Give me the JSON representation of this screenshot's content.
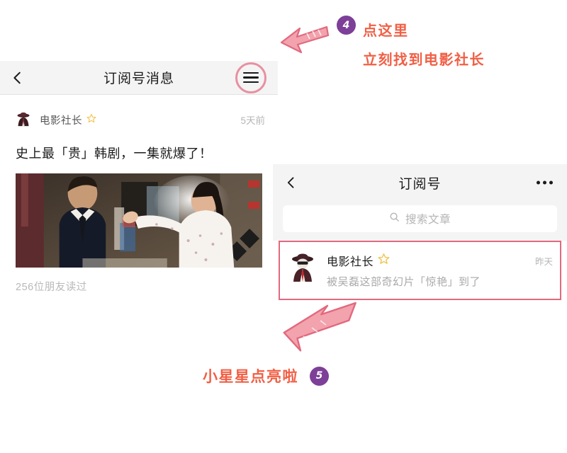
{
  "left_panel": {
    "header": {
      "back_icon": "chevron-left-icon",
      "title": "订阅号消息",
      "menu_icon": "hamburger-menu-icon",
      "menu_highlight_color": "#e8909f"
    },
    "feed_item": {
      "avatar": "movie-boss-avatar",
      "account_name": "电影社长",
      "star_icon": "star-outline-icon",
      "star_color": "#f2c14a",
      "timestamp": "5天前",
      "article_title": "史上最「贵」韩剧，一集就爆了！",
      "cover_image": "korean-drama-still",
      "read_count": "256位朋友读过"
    }
  },
  "right_panel": {
    "header": {
      "back_icon": "chevron-left-icon",
      "title": "订阅号",
      "more_icon": "more-dots-icon"
    },
    "search": {
      "icon": "search-icon",
      "placeholder": "搜索文章"
    },
    "list_items": [
      {
        "avatar": "movie-boss-avatar",
        "name": "电影社长",
        "star_icon": "star-outline-icon",
        "star_color": "#f2c14a",
        "timestamp": "昨天",
        "subtitle": "被吴磊这部奇幻片「惊艳」到了",
        "highlight_border_color": "#e2697e"
      }
    ]
  },
  "annotations": {
    "top": {
      "badge": "4",
      "line1": "点这里",
      "line2": "立刻找到电影社长",
      "arrow_icon": "pink-arrow-left-icon",
      "text_color": "#f15f45",
      "badge_color": "#7d3f98"
    },
    "bottom": {
      "badge": "5",
      "text": "小星星点亮啦",
      "arrow_icon": "pink-arrow-up-right-icon",
      "text_color": "#f15f45",
      "badge_color": "#7d3f98"
    }
  }
}
